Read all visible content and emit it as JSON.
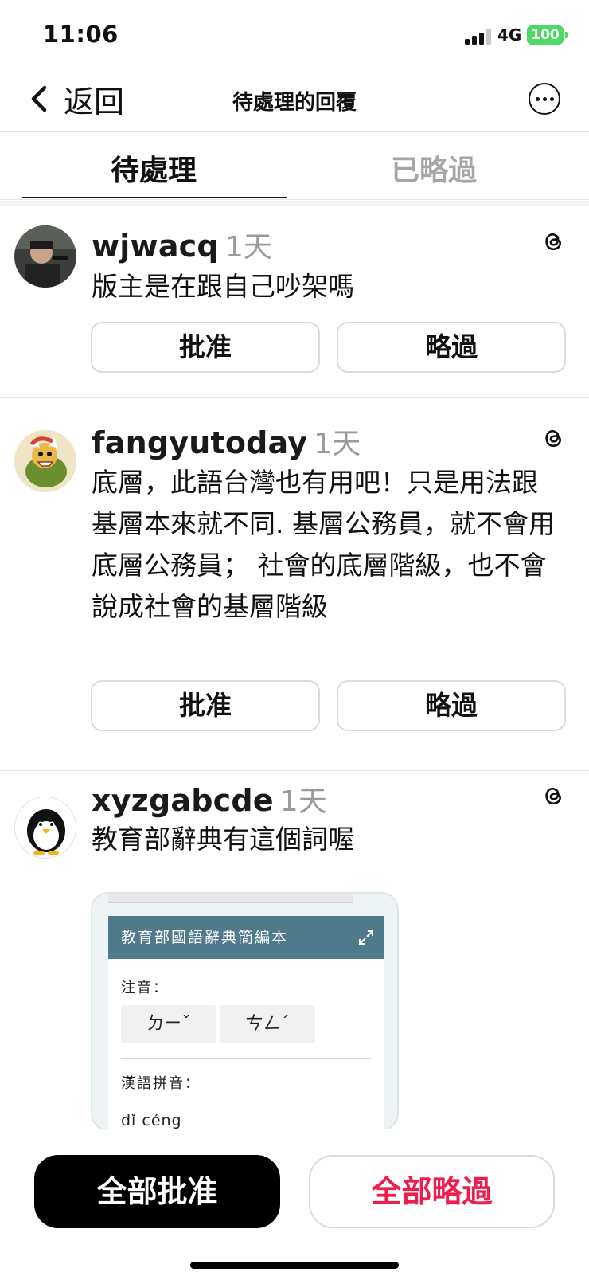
{
  "status": {
    "time": "11:06",
    "network": "4G",
    "battery": "100"
  },
  "header": {
    "back_label": "返回",
    "title": "待處理的回覆"
  },
  "tabs": [
    {
      "label": "待處理"
    },
    {
      "label": "已略過"
    }
  ],
  "comments": [
    {
      "username": "wjwacq",
      "time": "1天",
      "text": "版主是在跟自己吵架嗎",
      "approve_label": "批准",
      "skip_label": "略過"
    },
    {
      "username": "fangyutoday",
      "time": "1天",
      "text": "底層，此語台灣也有用吧！只是用法跟基層本來就不同. 基層公務員，就不會用底層公務員； 社會的底層階級，也不會說成社會的基層階級",
      "approve_label": "批准",
      "skip_label": "略過"
    },
    {
      "username": "xyzgabcde",
      "time": "1天",
      "text": "教育部辭典有這個詞喔"
    }
  ],
  "embed": {
    "header": "教育部國語辭典簡編本",
    "zhuyin_label": "注音：",
    "zhuyin": [
      "ㄉㄧˇ",
      "ㄘㄥˊ"
    ],
    "pinyin_label": "漢語拼音：",
    "pinyin": "dǐ céng"
  },
  "bottom": {
    "approve_all": "全部批准",
    "skip_all": "全部略過"
  },
  "colors": {
    "skip_all_text": "#ee1d4d",
    "battery": "#4cd964",
    "embed_header": "#4e7a8b"
  }
}
